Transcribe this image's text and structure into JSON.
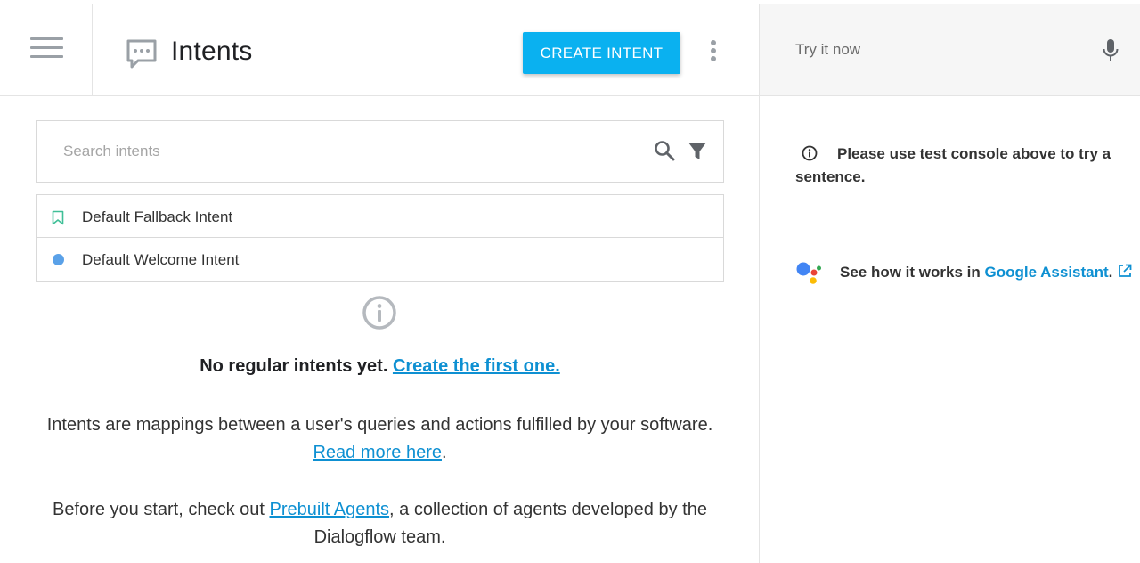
{
  "header": {
    "title": "Intents",
    "create_button": "CREATE INTENT"
  },
  "search": {
    "placeholder": "Search intents"
  },
  "intents": [
    {
      "name": "Default Fallback Intent",
      "icon": "bookmark-icon"
    },
    {
      "name": "Default Welcome Intent",
      "icon": "dot-icon"
    }
  ],
  "empty_state": {
    "title": "No regular intents yet.",
    "create_link": "Create the first one.",
    "desc1_text": "Intents are mappings between a user's queries and actions fulfilled by your software. ",
    "desc1_link": "Read more here",
    "desc1_end": ".",
    "desc2_start": "Before you start, check out ",
    "desc2_link": "Prebuilt Agents",
    "desc2_end": ", a collection of agents developed by the Dialogflow team."
  },
  "test_panel": {
    "try_placeholder": "Try it now",
    "info_text": "Please use test console above to try a sentence.",
    "assistant_text": "See how it works in ",
    "assistant_link": "Google Assistant",
    "assistant_end": "."
  },
  "colors": {
    "accent": "#0ab1f0",
    "link": "#0e90d2",
    "welcome_dot": "#5aa1e8",
    "fallback_bookmark": "#3fbf97"
  }
}
